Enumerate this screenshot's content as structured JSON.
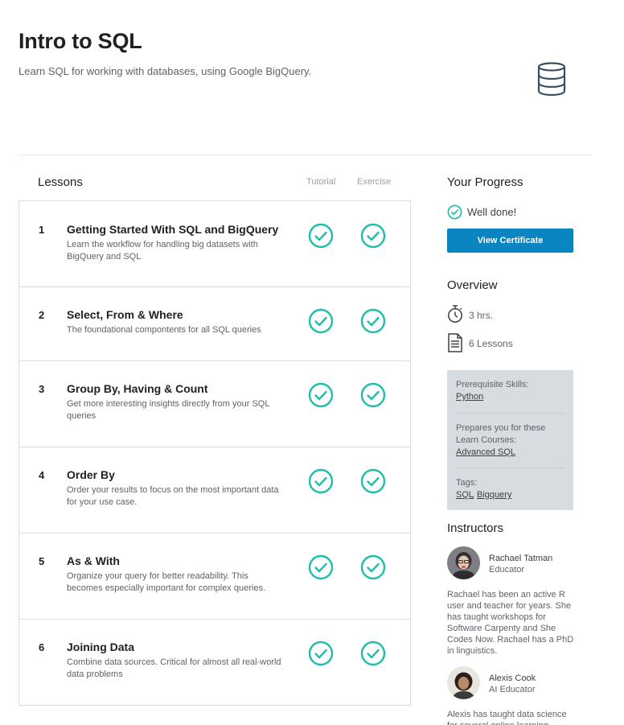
{
  "course": {
    "title": "Intro to SQL",
    "subtitle": "Learn SQL for working with databases, using Google BigQuery.",
    "icon": "database-icon"
  },
  "lessons_header": {
    "title": "Lessons",
    "tutorial_label": "Tutorial",
    "exercise_label": "Exercise"
  },
  "lessons": [
    {
      "num": "1",
      "title": "Getting Started With SQL and BigQuery",
      "desc": "Learn the workflow for handling big datasets with BigQuery and SQL",
      "tutorial_done": true,
      "exercise_done": true
    },
    {
      "num": "2",
      "title": "Select, From & Where",
      "desc": "The foundational compontents for all SQL queries",
      "tutorial_done": true,
      "exercise_done": true
    },
    {
      "num": "3",
      "title": "Group By, Having & Count",
      "desc": "Get more interesting insights directly from your SQL queries",
      "tutorial_done": true,
      "exercise_done": true
    },
    {
      "num": "4",
      "title": "Order By",
      "desc": "Order your results to focus on the most important data for your use case.",
      "tutorial_done": true,
      "exercise_done": true
    },
    {
      "num": "5",
      "title": "As & With",
      "desc": "Organize your query for better readability. This becomes especially important for complex queries.",
      "tutorial_done": true,
      "exercise_done": true
    },
    {
      "num": "6",
      "title": "Joining Data",
      "desc": "Combine data sources. Critical for almost all real-world data problems",
      "tutorial_done": true,
      "exercise_done": true
    }
  ],
  "progress": {
    "title": "Your Progress",
    "status": "Well done!",
    "button": "View Certificate"
  },
  "overview": {
    "title": "Overview",
    "duration": "3 hrs.",
    "lessons_count": "6 Lessons"
  },
  "info": {
    "prereq_label": "Prerequisite Skills:",
    "prereq_link": "Python",
    "prepares_label": "Prepares you for these Learn Courses:",
    "prepares_link": "Advanced SQL",
    "tags_label": "Tags:",
    "tags": [
      "SQL",
      "Bigquery"
    ]
  },
  "instructors": {
    "title": "Instructors",
    "people": [
      {
        "name": "Rachael Tatman",
        "role": "Educator",
        "bio": "Rachael has been an active R user and teacher for years. She has taught workshops for Software Carpenty and She Codes Now. Rachael has a PhD in linguistics."
      },
      {
        "name": "Alexis Cook",
        "role": "AI Educator",
        "bio": "Alexis has taught data science for several online learning"
      }
    ]
  },
  "colors": {
    "accent": "#0b85c2",
    "check": "#20beaa",
    "info_box": "#d6dce0"
  }
}
